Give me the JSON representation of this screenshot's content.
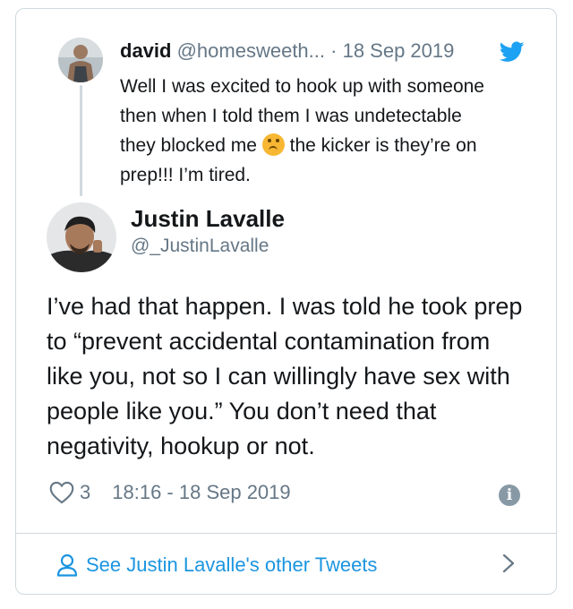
{
  "parent_tweet": {
    "author_name": "david",
    "author_handle": "@homesweeth...",
    "separator": "·",
    "date": "18 Sep 2019",
    "text_before_emoji": "Well I was excited to hook up with someone then when I told them I was undetectable they blocked me",
    "emoji_icon": "upside-down-face-emoji",
    "text_after_emoji": "the kicker is they’re on prep!!! I’m tired."
  },
  "main_tweet": {
    "author_name": "Justin Lavalle",
    "author_handle": "@_JustinLavalle",
    "text": "I’ve had that happen. I was told he took prep to “prevent accidental contamination from like you, not so I can willingly have sex with people like you.” You don’t need that negativity, hookup or not.",
    "like_count": "3",
    "timestamp": "18:16 - 18 Sep 2019"
  },
  "footer": {
    "link_label": "See Justin Lavalle's other Tweets"
  },
  "icons": {
    "brand": "twitter-bird-icon",
    "like": "heart-icon",
    "info": "info-icon",
    "person": "person-icon",
    "chevron": "chevron-right-icon"
  },
  "colors": {
    "accent": "#1da1f2",
    "link": "#1b95e0",
    "muted": "#657786",
    "border": "#cfd9de",
    "text": "#14171a"
  }
}
